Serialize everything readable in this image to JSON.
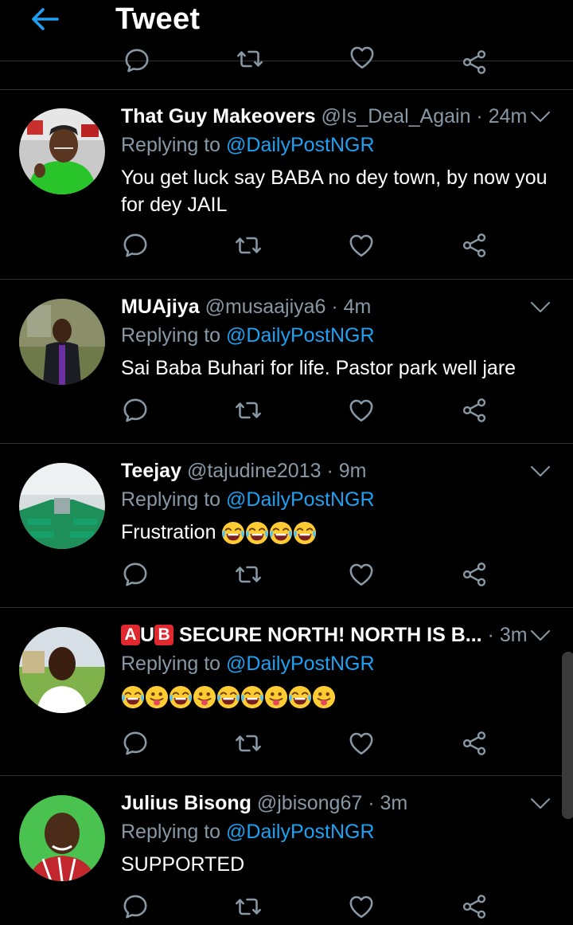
{
  "header": {
    "title": "Tweet"
  },
  "tweets": [
    {
      "name": "That Guy Makeovers",
      "handle": "@Is_Deal_Again",
      "dot": " · ",
      "time": "24m",
      "replying_prefix": "Replying to ",
      "replying_to": "@DailyPostNGR",
      "text": "You get luck say BABA no dey town, by now you for dey JAIL"
    },
    {
      "name": "MUAjiya",
      "handle": "@musaajiya6",
      "dot": " · ",
      "time": "4m",
      "replying_prefix": "Replying to ",
      "replying_to": "@DailyPostNGR",
      "text": "Sai Baba Buhari for life. Pastor park well jare"
    },
    {
      "name": "Teejay",
      "handle": "@tajudine2013",
      "dot": " · ",
      "time": "9m",
      "replying_prefix": "Replying to ",
      "replying_to": "@DailyPostNGR",
      "text": "Frustration"
    },
    {
      "name_box1": "A",
      "name_mid": "U",
      "name_box2": "B",
      "name": "SECURE NORTH! NORTH IS B...",
      "dot": " · ",
      "time": "3m",
      "replying_prefix": "Replying to ",
      "replying_to": "@DailyPostNGR"
    },
    {
      "name": "Julius Bisong",
      "handle": "@jbisong67",
      "dot": " · ",
      "time": "3m",
      "replying_prefix": "Replying to ",
      "replying_to": "@DailyPostNGR",
      "text": "SUPPORTED"
    }
  ],
  "icons": {
    "back": "arrow-left-icon",
    "reply": "comment-icon",
    "retweet": "retweet-icon",
    "like": "heart-icon",
    "share": "share-icon",
    "menu": "chevron-down-icon",
    "laugh": "face-with-tears-of-joy-emoji",
    "tongue": "face-with-tongue-emoji"
  },
  "colors": {
    "background": "#000000",
    "accent": "#1da1f2",
    "secondary_text": "#8899a6",
    "divider": "#2f3336",
    "box_letter": "#e0282e"
  }
}
